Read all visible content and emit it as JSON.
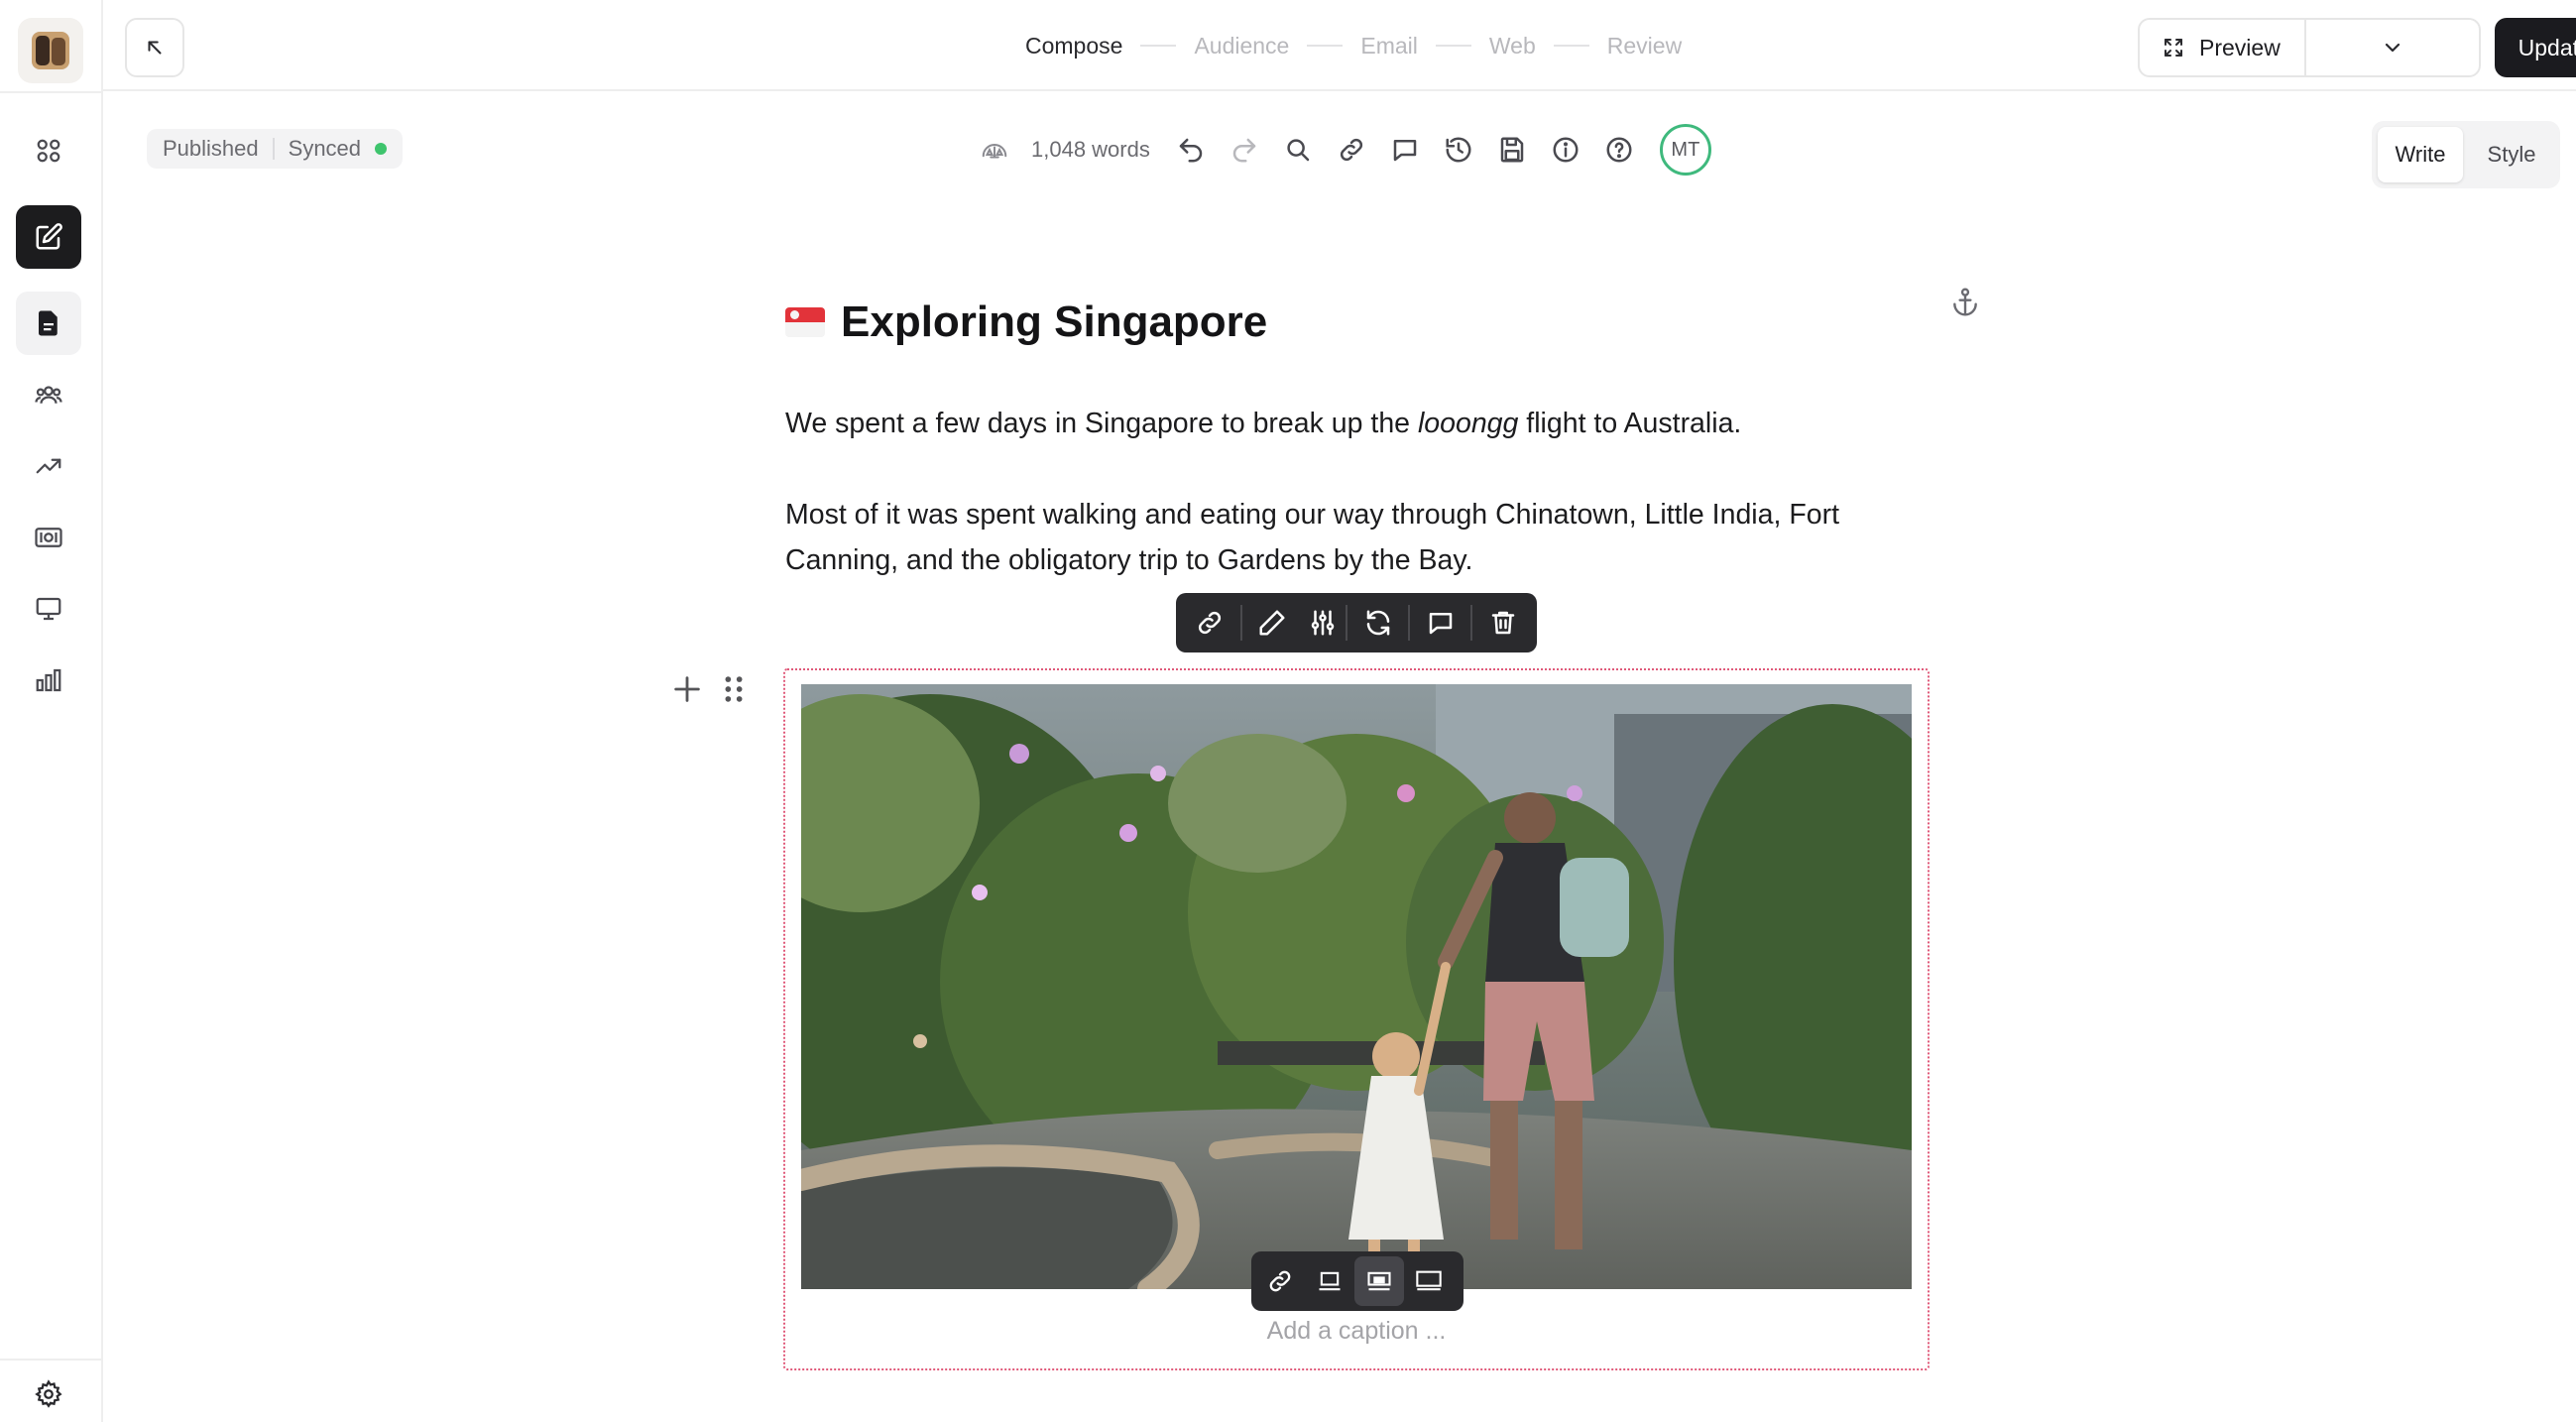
{
  "topbar": {
    "steps": [
      {
        "label": "Compose"
      },
      {
        "label": "Audience"
      },
      {
        "label": "Email"
      },
      {
        "label": "Web"
      },
      {
        "label": "Review"
      }
    ],
    "preview_label": "Preview",
    "update_label": "Update web"
  },
  "sidebar": {
    "items": [
      {
        "icon": "dashboard-grid-icon"
      },
      {
        "icon": "edit-icon",
        "active": true
      },
      {
        "icon": "document-icon"
      },
      {
        "icon": "users-icon"
      },
      {
        "icon": "trending-up-icon"
      },
      {
        "icon": "money-icon"
      },
      {
        "icon": "monitor-icon"
      },
      {
        "icon": "bar-chart-icon"
      }
    ],
    "settings_icon": "settings-icon"
  },
  "status": {
    "published": "Published",
    "synced": "Synced",
    "synced_color": "#3ec46d"
  },
  "editor_toolbar": {
    "word_count": "1,048 words",
    "user_initials": "MT",
    "user_ring_color": "#3fb97d"
  },
  "mode": {
    "write": "Write",
    "style": "Style",
    "active": "Write"
  },
  "document": {
    "title": "Exploring Singapore",
    "title_flag": "singapore-flag",
    "p1_before": "We spent a few days in Singapore to break up the ",
    "p1_em": "looongg",
    "p1_after": " flight to Australia.",
    "p2": "Most of it was spent walking and eating our way through Chinatown, Little India, Fort Canning, and the obligatory trip to Gardens by the Bay.",
    "image_caption_placeholder": "Add a caption ..."
  },
  "colors": {
    "primary_dark": "#1b1b1f",
    "selection_border": "#e05a7a"
  }
}
